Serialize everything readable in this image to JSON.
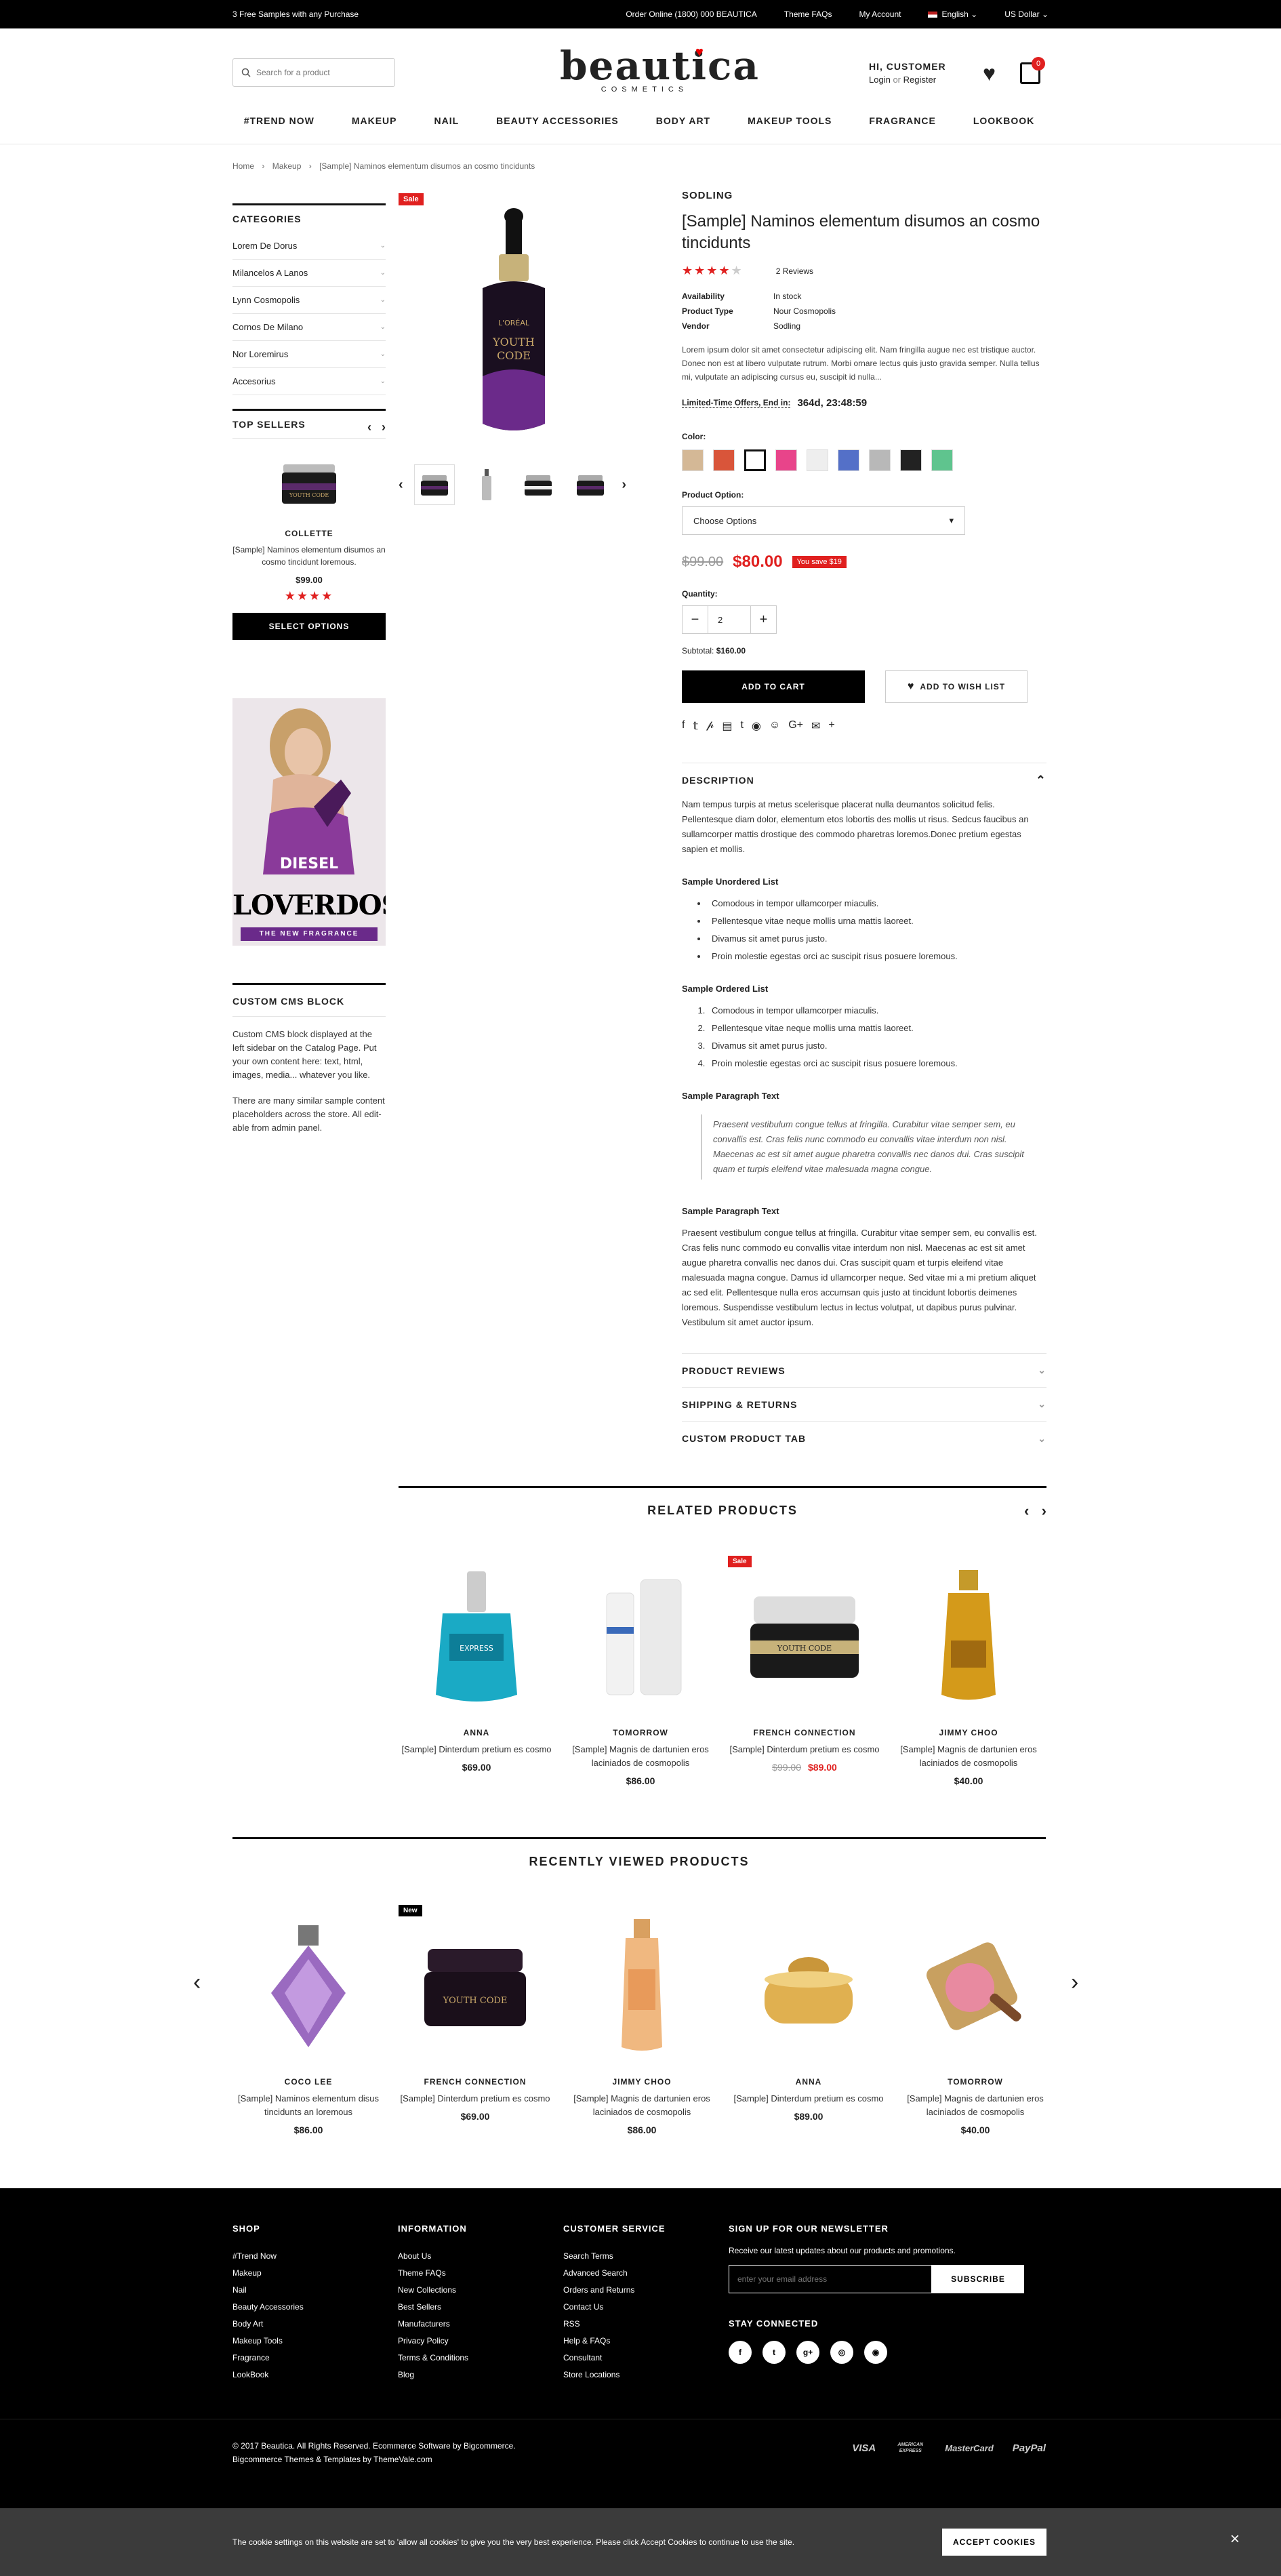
{
  "topbar": {
    "promo": "3 Free Samples with any Purchase",
    "order_online": "Order Online (1800) 000 BEAUTICA",
    "theme_faqs": "Theme FAQs",
    "my_account": "My Account",
    "language": "English",
    "currency": "US Dollar"
  },
  "header": {
    "search_placeholder": "Search for a product",
    "logo_main": "beautica",
    "logo_sub": "COSMETICS",
    "greeting": "HI, CUSTOMER",
    "login": "Login",
    "or": "or",
    "register": "Register",
    "cart_count": "0"
  },
  "nav": [
    "#TREND NOW",
    "MAKEUP",
    "NAIL",
    "BEAUTY ACCESSORIES",
    "BODY ART",
    "MAKEUP TOOLS",
    "FRAGRANCE",
    "LOOKBOOK"
  ],
  "breadcrumb": [
    "Home",
    "Makeup",
    "[Sample] Naminos elementum disumos an cosmo tincidunts"
  ],
  "sidebar": {
    "categories_title": "CATEGORIES",
    "categories": [
      "Lorem De Dorus",
      "Milancelos A Lanos",
      "Lynn Cosmopolis",
      "Cornos De Milano",
      "Nor Loremirus",
      "Accesorius"
    ],
    "top_sellers_title": "TOP SELLERS",
    "top_seller": {
      "name": "COLLETTE",
      "desc": "[Sample] Naminos elementum disumos an cosmo tincidunt loremous.",
      "price": "$99.00",
      "stars": "★★★★",
      "button": "SELECT OPTIONS"
    },
    "promo": {
      "brand": "DIESEL",
      "title": "LOVERDOSE",
      "tagline": "THE NEW FRAGRANCE"
    },
    "cms_title": "CUSTOM CMS BLOCK",
    "cms_text1": "Custom CMS block displayed at the left sidebar on the Catalog Page. Put your own content here: text, html, images, media... whatever you like.",
    "cms_text2": "There are many similar sample content placeholders across the store. All edit-able from admin panel."
  },
  "product": {
    "sale_badge": "Sale",
    "brand": "SODLING",
    "title": "[Sample] Naminos elementum disumos an cosmo tincidunts",
    "stars": "★★★★",
    "stars_empty": "★",
    "reviews": "2 Reviews",
    "availability_label": "Availability",
    "availability_value": "In stock",
    "type_label": "Product Type",
    "type_value": "Nour Cosmopolis",
    "vendor_label": "Vendor",
    "vendor_value": "Sodling",
    "short_desc": "Lorem ipsum dolor sit amet consectetur adipiscing elit. Nam fringilla augue nec est tristique auctor. Donec non est at libero vulputate rutrum. Morbi ornare lectus quis justo gravida semper. Nulla tellus mi, vulputate an adipiscing cursus eu, suscipit id nulla...",
    "offer_label": "Limited-Time Offers, End in:",
    "offer_countdown": "364d, 23:48:59",
    "color_label": "Color:",
    "colors": [
      "#d4b896",
      "#d9553a",
      "#ffffff",
      "#e8448a",
      "#eeeeee",
      "#5470c8",
      "#b8b8b8",
      "#222222",
      "#5fc48e"
    ],
    "option_label": "Product Option:",
    "option_value": "Choose Options",
    "old_price": "$99.00",
    "price": "$80.00",
    "save_badge": "You save $19",
    "quantity_label": "Quantity:",
    "quantity": "2",
    "subtotal_label": "Subtotal:",
    "subtotal_value": "$160.00",
    "add_to_cart": "ADD TO CART",
    "wishlist": "ADD TO WISH LIST"
  },
  "description": {
    "title": "DESCRIPTION",
    "intro": "Nam tempus turpis at metus scelerisque placerat nulla deumantos solicitud felis. Pellentesque diam dolor, elementum etos lobortis des mollis ut risus. Sedcus faucibus an sullamcorper mattis drostique des commodo pharetras loremos.Donec pretium egestas sapien et mollis.",
    "ul_title": "Sample Unordered List",
    "ul": [
      "Comodous in tempor ullamcorper miaculis.",
      "Pellentesque vitae neque mollis urna mattis laoreet.",
      "Divamus sit amet purus justo.",
      "Proin molestie egestas orci ac suscipit risus posuere loremous."
    ],
    "ol_title": "Sample Ordered List",
    "ol": [
      "Comodous in tempor ullamcorper miaculis.",
      "Pellentesque vitae neque mollis urna mattis laoreet.",
      "Divamus sit amet purus justo.",
      "Proin molestie egestas orci ac suscipit risus posuere loremous."
    ],
    "p1_title": "Sample Paragraph Text",
    "quote": "Praesent vestibulum congue tellus at fringilla. Curabitur vitae semper sem, eu convallis est. Cras felis nunc commodo eu convallis vitae interdum non nisl. Maecenas ac est sit amet augue pharetra convallis nec danos dui. Cras suscipit quam et turpis eleifend vitae malesuada magna congue.",
    "p2_title": "Sample Paragraph Text",
    "p2": "Praesent vestibulum congue tellus at fringilla. Curabitur vitae semper sem, eu convallis est. Cras felis nunc commodo eu convallis vitae interdum non nisl. Maecenas ac est sit amet augue pharetra convallis nec danos dui. Cras suscipit quam et turpis eleifend vitae malesuada magna congue. Damus id ullamcorper neque. Sed vitae mi a mi pretium aliquet ac sed elit. Pellentesque nulla eros accumsan quis justo at tincidunt lobortis deimenes loremous. Suspendisse vestibulum lectus in lectus volutpat, ut dapibus purus pulvinar. Vestibulum sit amet auctor ipsum."
  },
  "tabs": [
    "PRODUCT REVIEWS",
    "SHIPPING & RETURNS",
    "CUSTOM PRODUCT TAB"
  ],
  "related": {
    "title": "RELATED PRODUCTS",
    "items": [
      {
        "name": "ANNA",
        "desc": "[Sample] Dinterdum pretium es cosmo",
        "price": "$69.00",
        "old": "",
        "tag": ""
      },
      {
        "name": "TOMORROW",
        "desc": "[Sample] Magnis de dartunien eros laciniados de cosmopolis",
        "price": "$86.00",
        "old": "",
        "tag": ""
      },
      {
        "name": "FRENCH CONNECTION",
        "desc": "[Sample] Dinterdum pretium es cosmo",
        "price": "$89.00",
        "old": "$99.00",
        "tag": "Sale"
      },
      {
        "name": "JIMMY CHOO",
        "desc": "[Sample] Magnis de dartunien eros laciniados de cosmopolis",
        "price": "$40.00",
        "old": "",
        "tag": ""
      }
    ]
  },
  "recent": {
    "title": "RECENTLY VIEWED PRODUCTS",
    "items": [
      {
        "name": "COCO LEE",
        "desc": "[Sample] Naminos elementum disus tincidunts an loremous",
        "price": "$86.00",
        "tag": ""
      },
      {
        "name": "FRENCH CONNECTION",
        "desc": "[Sample] Dinterdum pretium es cosmo",
        "price": "$69.00",
        "tag": "New"
      },
      {
        "name": "JIMMY CHOO",
        "desc": "[Sample] Magnis de dartunien eros laciniados de cosmopolis",
        "price": "$86.00",
        "tag": ""
      },
      {
        "name": "ANNA",
        "desc": "[Sample] Dinterdum pretium es cosmo",
        "price": "$89.00",
        "tag": ""
      },
      {
        "name": "TOMORROW",
        "desc": "[Sample] Magnis de dartunien eros laciniados de cosmopolis",
        "price": "$40.00",
        "tag": ""
      }
    ]
  },
  "footer": {
    "shop_title": "SHOP",
    "shop": [
      "#Trend Now",
      "Makeup",
      "Nail",
      "Beauty Accessories",
      "Body Art",
      "Makeup Tools",
      "Fragrance",
      "LookBook"
    ],
    "info_title": "INFORMATION",
    "info": [
      "About Us",
      "Theme FAQs",
      "New Collections",
      "Best Sellers",
      "Manufacturers",
      "Privacy Policy",
      "Terms & Conditions",
      "Blog"
    ],
    "cs_title": "CUSTOMER SERVICE",
    "cs": [
      "Search Terms",
      "Advanced Search",
      "Orders and Returns",
      "Contact Us",
      "RSS",
      "Help & FAQs",
      "Consultant",
      "Store Locations"
    ],
    "nl_title": "SIGN UP FOR OUR NEWSLETTER",
    "nl_text": "Receive our latest updates about our products and promotions.",
    "nl_placeholder": "enter your email address",
    "nl_button": "SUBSCRIBE",
    "stay_title": "STAY CONNECTED",
    "social": [
      "f",
      "t",
      "g+",
      "◎",
      "◉"
    ],
    "copyright1": "© 2017 Beautica. All Rights Reserved. Ecommerce Software by Bigcommerce.",
    "copyright2": "Bigcommerce Themes & Templates by ThemeVale.com",
    "payments": [
      "VISA",
      "AMERICAN EXPRESS",
      "MasterCard",
      "PayPal"
    ]
  },
  "cookie": {
    "text": "The cookie settings on this website are set to 'allow all cookies' to give you the very best experience. Please click Accept Cookies to continue to use the site.",
    "button": "ACCEPT COOKIES",
    "close": "×"
  }
}
